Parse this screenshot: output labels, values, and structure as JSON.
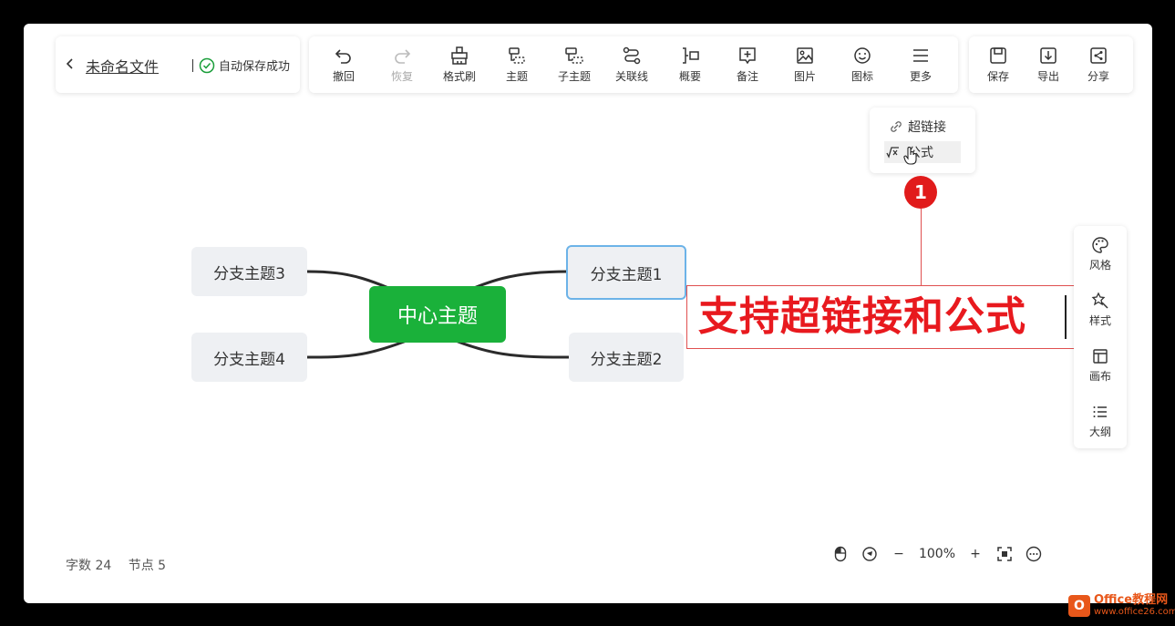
{
  "file": {
    "back_icon": "chevron-left-icon",
    "name": "未命名文件",
    "save_status": "自动保存成功"
  },
  "toolbar": {
    "undo": "撤回",
    "redo": "恢复",
    "format_painter": "格式刷",
    "topic": "主题",
    "subtopic": "子主题",
    "relation": "关联线",
    "summary": "概要",
    "note": "备注",
    "image": "图片",
    "icon": "图标",
    "more": "更多"
  },
  "toolbar_right": {
    "save": "保存",
    "export": "导出",
    "share": "分享"
  },
  "more_menu": {
    "hyperlink": "超链接",
    "formula": "公式"
  },
  "mindmap": {
    "center": "中心主题",
    "branches": [
      "分支主题1",
      "分支主题2",
      "分支主题3",
      "分支主题4"
    ]
  },
  "annotation": {
    "text": "支持超链接和公式",
    "badge": "1"
  },
  "sidebar": {
    "style": "风格",
    "theme": "样式",
    "canvas": "画布",
    "outline": "大纲"
  },
  "status": {
    "word_count": "字数 24",
    "node_count": "节点 5"
  },
  "zoom": {
    "level": "100%",
    "minus": "−",
    "plus": "+"
  },
  "watermark": {
    "brand": "Office教程网",
    "url": "www.office26.com"
  },
  "colors": {
    "center_node": "#1ab13a",
    "annotation": "#e8191e",
    "selected_border": "#6cb3e8"
  }
}
